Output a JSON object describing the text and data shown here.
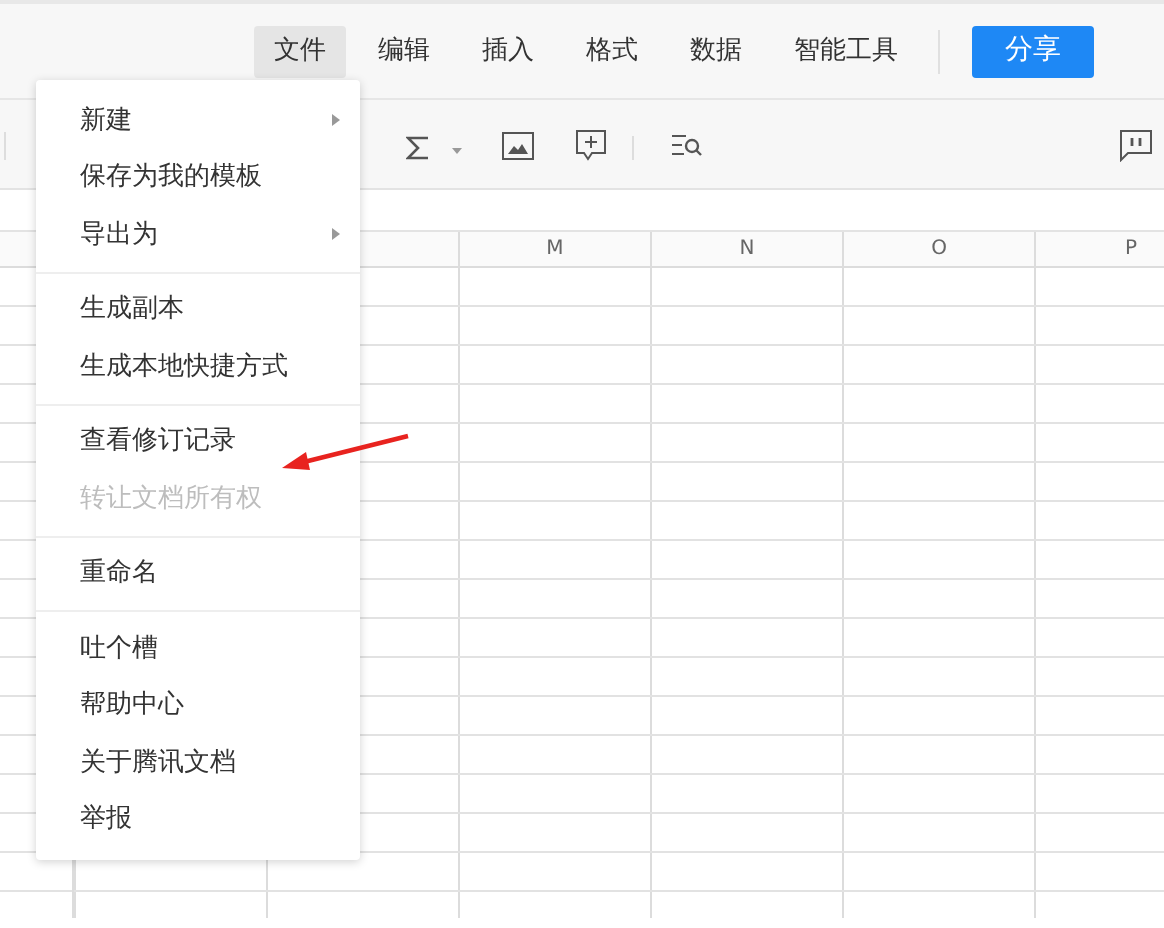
{
  "menu_bar": [
    {
      "label": "文件",
      "selected": true
    },
    {
      "label": "编辑",
      "selected": false
    },
    {
      "label": "插入",
      "selected": false
    },
    {
      "label": "格式",
      "selected": false
    },
    {
      "label": "数据",
      "selected": false
    },
    {
      "label": "智能工具",
      "selected": false
    }
  ],
  "share_button": "分享",
  "columns": [
    "M",
    "N",
    "O",
    "P"
  ],
  "file_menu": [
    [
      {
        "label": "新建",
        "submenu": true,
        "disabled": false
      },
      {
        "label": "保存为我的模板",
        "submenu": false,
        "disabled": false
      },
      {
        "label": "导出为",
        "submenu": true,
        "disabled": false
      }
    ],
    [
      {
        "label": "生成副本",
        "submenu": false,
        "disabled": false
      },
      {
        "label": "生成本地快捷方式",
        "submenu": false,
        "disabled": false
      }
    ],
    [
      {
        "label": "查看修订记录",
        "submenu": false,
        "disabled": false
      },
      {
        "label": "转让文档所有权",
        "submenu": false,
        "disabled": true
      }
    ],
    [
      {
        "label": "重命名",
        "submenu": false,
        "disabled": false
      }
    ],
    [
      {
        "label": "吐个槽",
        "submenu": false,
        "disabled": false
      },
      {
        "label": "帮助中心",
        "submenu": false,
        "disabled": false
      },
      {
        "label": "关于腾讯文档",
        "submenu": false,
        "disabled": false
      },
      {
        "label": "举报",
        "submenu": false,
        "disabled": false
      }
    ]
  ]
}
